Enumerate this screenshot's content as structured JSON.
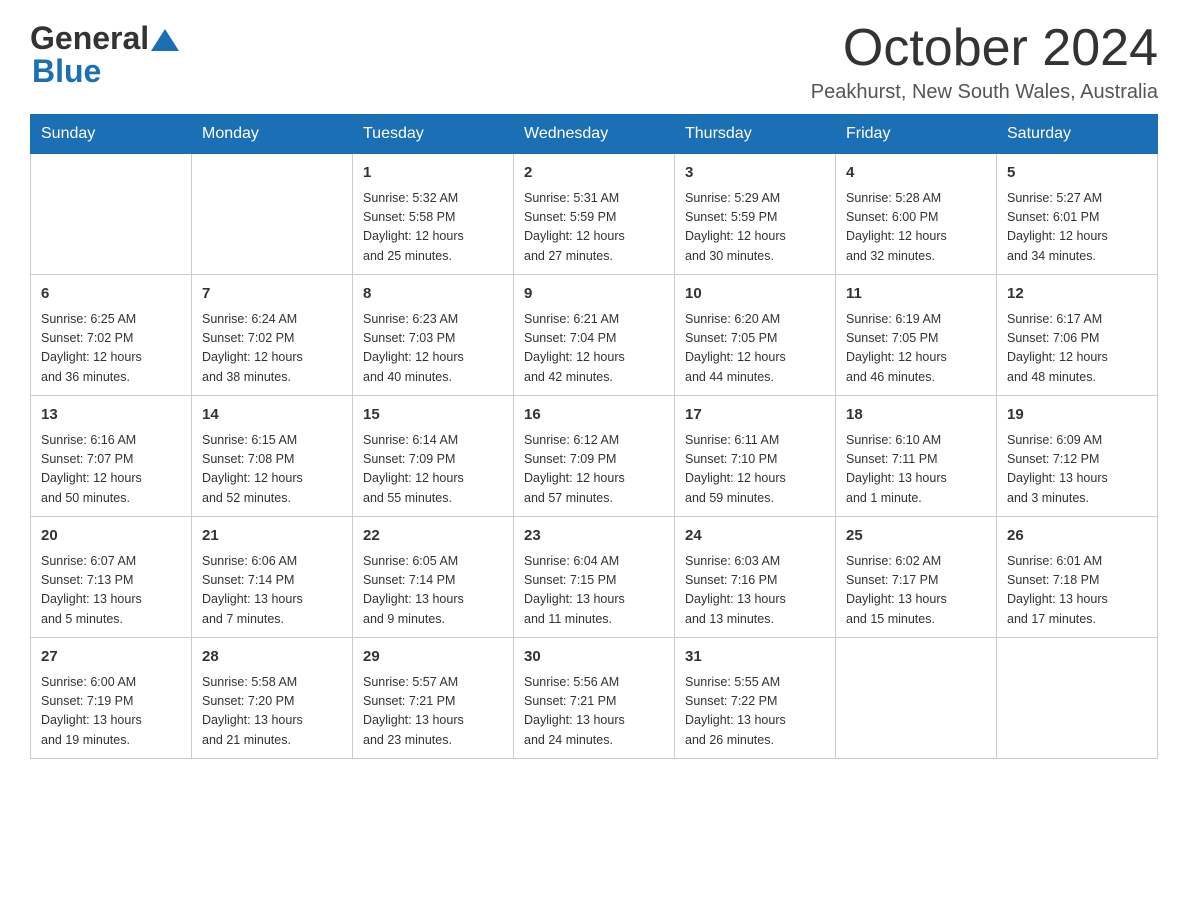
{
  "header": {
    "logo_line1": "General",
    "logo_line2": "Blue",
    "month_title": "October 2024",
    "location": "Peakhurst, New South Wales, Australia"
  },
  "days_of_week": [
    "Sunday",
    "Monday",
    "Tuesday",
    "Wednesday",
    "Thursday",
    "Friday",
    "Saturday"
  ],
  "weeks": [
    [
      {
        "day": "",
        "info": ""
      },
      {
        "day": "",
        "info": ""
      },
      {
        "day": "1",
        "info": "Sunrise: 5:32 AM\nSunset: 5:58 PM\nDaylight: 12 hours\nand 25 minutes."
      },
      {
        "day": "2",
        "info": "Sunrise: 5:31 AM\nSunset: 5:59 PM\nDaylight: 12 hours\nand 27 minutes."
      },
      {
        "day": "3",
        "info": "Sunrise: 5:29 AM\nSunset: 5:59 PM\nDaylight: 12 hours\nand 30 minutes."
      },
      {
        "day": "4",
        "info": "Sunrise: 5:28 AM\nSunset: 6:00 PM\nDaylight: 12 hours\nand 32 minutes."
      },
      {
        "day": "5",
        "info": "Sunrise: 5:27 AM\nSunset: 6:01 PM\nDaylight: 12 hours\nand 34 minutes."
      }
    ],
    [
      {
        "day": "6",
        "info": "Sunrise: 6:25 AM\nSunset: 7:02 PM\nDaylight: 12 hours\nand 36 minutes."
      },
      {
        "day": "7",
        "info": "Sunrise: 6:24 AM\nSunset: 7:02 PM\nDaylight: 12 hours\nand 38 minutes."
      },
      {
        "day": "8",
        "info": "Sunrise: 6:23 AM\nSunset: 7:03 PM\nDaylight: 12 hours\nand 40 minutes."
      },
      {
        "day": "9",
        "info": "Sunrise: 6:21 AM\nSunset: 7:04 PM\nDaylight: 12 hours\nand 42 minutes."
      },
      {
        "day": "10",
        "info": "Sunrise: 6:20 AM\nSunset: 7:05 PM\nDaylight: 12 hours\nand 44 minutes."
      },
      {
        "day": "11",
        "info": "Sunrise: 6:19 AM\nSunset: 7:05 PM\nDaylight: 12 hours\nand 46 minutes."
      },
      {
        "day": "12",
        "info": "Sunrise: 6:17 AM\nSunset: 7:06 PM\nDaylight: 12 hours\nand 48 minutes."
      }
    ],
    [
      {
        "day": "13",
        "info": "Sunrise: 6:16 AM\nSunset: 7:07 PM\nDaylight: 12 hours\nand 50 minutes."
      },
      {
        "day": "14",
        "info": "Sunrise: 6:15 AM\nSunset: 7:08 PM\nDaylight: 12 hours\nand 52 minutes."
      },
      {
        "day": "15",
        "info": "Sunrise: 6:14 AM\nSunset: 7:09 PM\nDaylight: 12 hours\nand 55 minutes."
      },
      {
        "day": "16",
        "info": "Sunrise: 6:12 AM\nSunset: 7:09 PM\nDaylight: 12 hours\nand 57 minutes."
      },
      {
        "day": "17",
        "info": "Sunrise: 6:11 AM\nSunset: 7:10 PM\nDaylight: 12 hours\nand 59 minutes."
      },
      {
        "day": "18",
        "info": "Sunrise: 6:10 AM\nSunset: 7:11 PM\nDaylight: 13 hours\nand 1 minute."
      },
      {
        "day": "19",
        "info": "Sunrise: 6:09 AM\nSunset: 7:12 PM\nDaylight: 13 hours\nand 3 minutes."
      }
    ],
    [
      {
        "day": "20",
        "info": "Sunrise: 6:07 AM\nSunset: 7:13 PM\nDaylight: 13 hours\nand 5 minutes."
      },
      {
        "day": "21",
        "info": "Sunrise: 6:06 AM\nSunset: 7:14 PM\nDaylight: 13 hours\nand 7 minutes."
      },
      {
        "day": "22",
        "info": "Sunrise: 6:05 AM\nSunset: 7:14 PM\nDaylight: 13 hours\nand 9 minutes."
      },
      {
        "day": "23",
        "info": "Sunrise: 6:04 AM\nSunset: 7:15 PM\nDaylight: 13 hours\nand 11 minutes."
      },
      {
        "day": "24",
        "info": "Sunrise: 6:03 AM\nSunset: 7:16 PM\nDaylight: 13 hours\nand 13 minutes."
      },
      {
        "day": "25",
        "info": "Sunrise: 6:02 AM\nSunset: 7:17 PM\nDaylight: 13 hours\nand 15 minutes."
      },
      {
        "day": "26",
        "info": "Sunrise: 6:01 AM\nSunset: 7:18 PM\nDaylight: 13 hours\nand 17 minutes."
      }
    ],
    [
      {
        "day": "27",
        "info": "Sunrise: 6:00 AM\nSunset: 7:19 PM\nDaylight: 13 hours\nand 19 minutes."
      },
      {
        "day": "28",
        "info": "Sunrise: 5:58 AM\nSunset: 7:20 PM\nDaylight: 13 hours\nand 21 minutes."
      },
      {
        "day": "29",
        "info": "Sunrise: 5:57 AM\nSunset: 7:21 PM\nDaylight: 13 hours\nand 23 minutes."
      },
      {
        "day": "30",
        "info": "Sunrise: 5:56 AM\nSunset: 7:21 PM\nDaylight: 13 hours\nand 24 minutes."
      },
      {
        "day": "31",
        "info": "Sunrise: 5:55 AM\nSunset: 7:22 PM\nDaylight: 13 hours\nand 26 minutes."
      },
      {
        "day": "",
        "info": ""
      },
      {
        "day": "",
        "info": ""
      }
    ]
  ]
}
